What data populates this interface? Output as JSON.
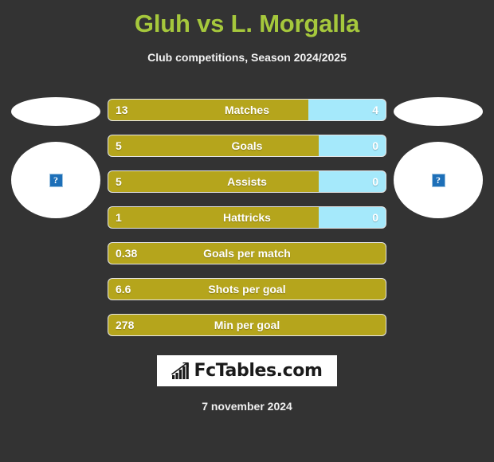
{
  "header": {
    "title": "Gluh vs L. Morgalla",
    "subtitle": "Club competitions, Season 2024/2025",
    "title_color": "#a6c83c"
  },
  "players": {
    "home": {
      "placeholder_icon": "broken-image-icon",
      "placeholder_glyph": "?"
    },
    "away": {
      "placeholder_icon": "broken-image-icon",
      "placeholder_glyph": "?"
    }
  },
  "colors": {
    "background": "#333333",
    "home_bar": "#b5a51c",
    "away_bar": "#a5e9fb",
    "text": "#ffffff"
  },
  "chart_data": {
    "type": "bar",
    "title": "Gluh vs L. Morgalla",
    "subtitle": "Club competitions, Season 2024/2025",
    "orientation": "horizontal-diverging",
    "series": [
      {
        "name": "Gluh",
        "color": "#b5a51c"
      },
      {
        "name": "L. Morgalla",
        "color": "#a5e9fb"
      }
    ],
    "categories": [
      "Matches",
      "Goals",
      "Assists",
      "Hattricks",
      "Goals per match",
      "Shots per goal",
      "Min per goal"
    ],
    "rows": [
      {
        "label": "Matches",
        "home": "13",
        "away": "4",
        "home_pct": 72,
        "two_sided": true
      },
      {
        "label": "Goals",
        "home": "5",
        "away": "0",
        "home_pct": 76,
        "two_sided": true
      },
      {
        "label": "Assists",
        "home": "5",
        "away": "0",
        "home_pct": 76,
        "two_sided": true
      },
      {
        "label": "Hattricks",
        "home": "1",
        "away": "0",
        "home_pct": 76,
        "two_sided": true
      },
      {
        "label": "Goals per match",
        "home": "0.38",
        "away": "",
        "home_pct": 100,
        "two_sided": false
      },
      {
        "label": "Shots per goal",
        "home": "6.6",
        "away": "",
        "home_pct": 100,
        "two_sided": false
      },
      {
        "label": "Min per goal",
        "home": "278",
        "away": "",
        "home_pct": 100,
        "two_sided": false
      }
    ]
  },
  "logo": {
    "text": "FcTables.com",
    "icon": "bar-chart-growth-icon"
  },
  "footer": {
    "date": "7 november 2024"
  }
}
